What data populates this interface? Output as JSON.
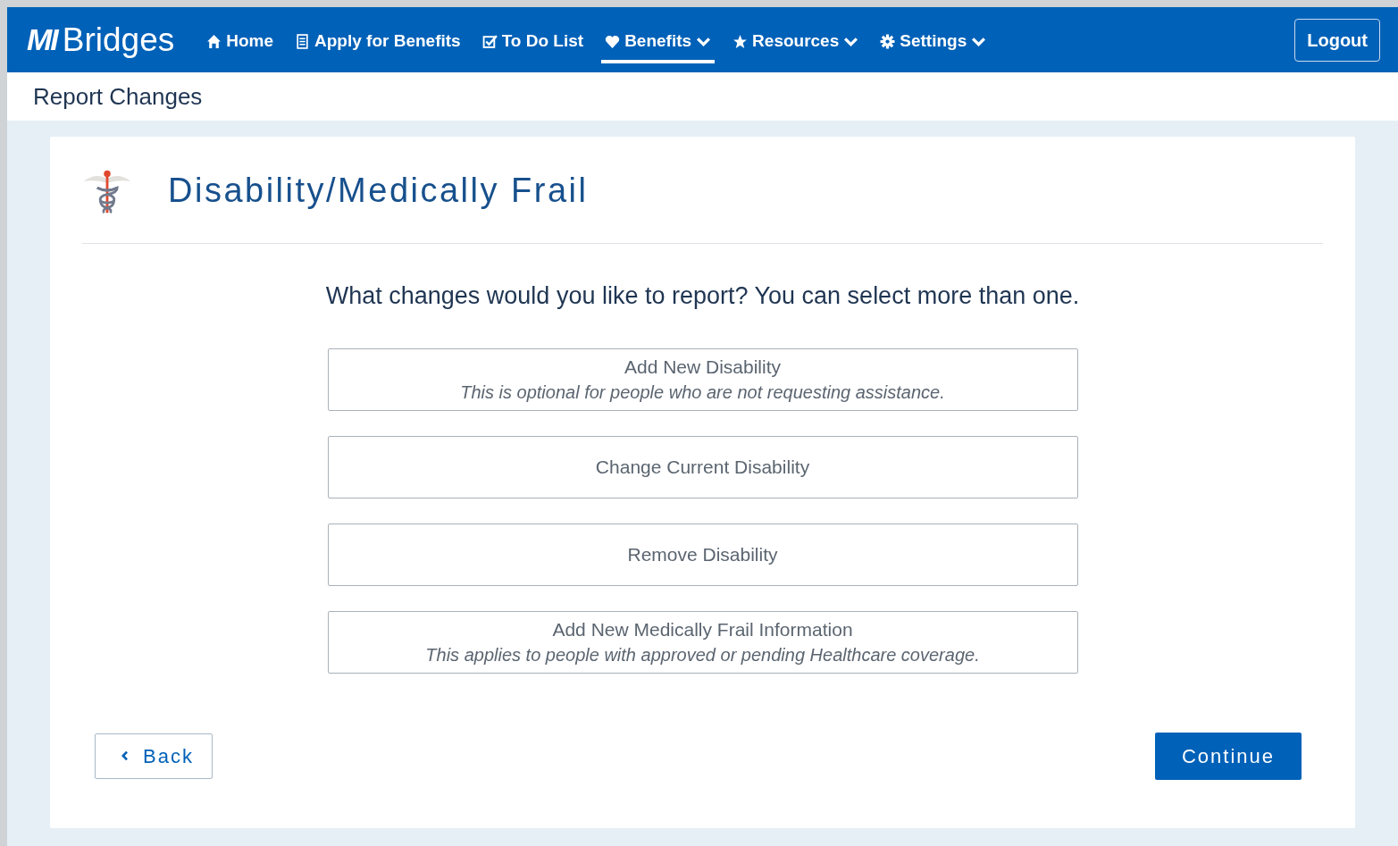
{
  "header": {
    "logo_mark": "MI",
    "logo_text": "Bridges",
    "nav": [
      {
        "label": "Home",
        "kind": "home",
        "selected": false,
        "dropdown": false
      },
      {
        "label": "Apply for Benefits",
        "kind": "form",
        "selected": false,
        "dropdown": false
      },
      {
        "label": "To Do List",
        "kind": "check",
        "selected": false,
        "dropdown": false
      },
      {
        "label": "Benefits",
        "kind": "heart",
        "selected": true,
        "dropdown": true
      },
      {
        "label": "Resources",
        "kind": "star",
        "selected": false,
        "dropdown": true
      },
      {
        "label": "Settings",
        "kind": "gear",
        "selected": false,
        "dropdown": true
      }
    ],
    "logout": "Logout"
  },
  "page_title": "Report Changes",
  "card": {
    "title": "Disability/Medically Frail",
    "question": "What changes would you like to report? You can select more than one.",
    "options": [
      {
        "label": "Add New Disability",
        "note": "This is optional for people who are not requesting assistance.",
        "selected": false
      },
      {
        "label": "Change Current Disability",
        "selected": false
      },
      {
        "label": "Remove Disability",
        "selected": false
      },
      {
        "label": "Add New Medically Frail Information",
        "note": "This applies to people with approved or pending Healthcare coverage.",
        "selected": false
      }
    ],
    "back": "Back",
    "continue": "Continue"
  }
}
